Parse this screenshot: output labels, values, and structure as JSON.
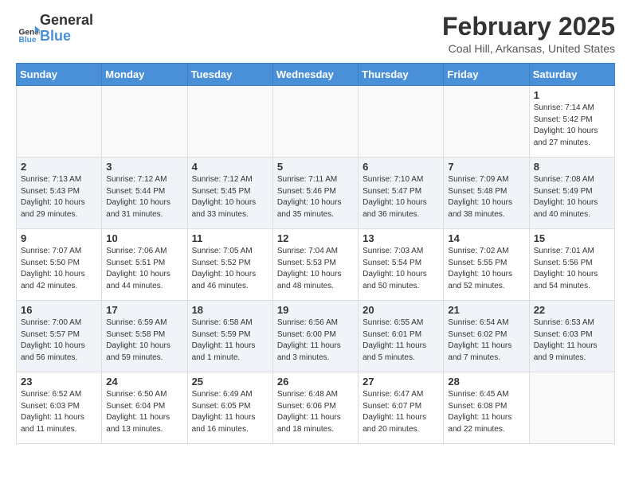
{
  "header": {
    "logo_general": "General",
    "logo_blue": "Blue",
    "month_title": "February 2025",
    "location": "Coal Hill, Arkansas, United States"
  },
  "calendar": {
    "days_of_week": [
      "Sunday",
      "Monday",
      "Tuesday",
      "Wednesday",
      "Thursday",
      "Friday",
      "Saturday"
    ],
    "weeks": [
      {
        "shade": false,
        "days": [
          {
            "num": "",
            "info": ""
          },
          {
            "num": "",
            "info": ""
          },
          {
            "num": "",
            "info": ""
          },
          {
            "num": "",
            "info": ""
          },
          {
            "num": "",
            "info": ""
          },
          {
            "num": "",
            "info": ""
          },
          {
            "num": "1",
            "info": "Sunrise: 7:14 AM\nSunset: 5:42 PM\nDaylight: 10 hours and 27 minutes."
          }
        ]
      },
      {
        "shade": true,
        "days": [
          {
            "num": "2",
            "info": "Sunrise: 7:13 AM\nSunset: 5:43 PM\nDaylight: 10 hours and 29 minutes."
          },
          {
            "num": "3",
            "info": "Sunrise: 7:12 AM\nSunset: 5:44 PM\nDaylight: 10 hours and 31 minutes."
          },
          {
            "num": "4",
            "info": "Sunrise: 7:12 AM\nSunset: 5:45 PM\nDaylight: 10 hours and 33 minutes."
          },
          {
            "num": "5",
            "info": "Sunrise: 7:11 AM\nSunset: 5:46 PM\nDaylight: 10 hours and 35 minutes."
          },
          {
            "num": "6",
            "info": "Sunrise: 7:10 AM\nSunset: 5:47 PM\nDaylight: 10 hours and 36 minutes."
          },
          {
            "num": "7",
            "info": "Sunrise: 7:09 AM\nSunset: 5:48 PM\nDaylight: 10 hours and 38 minutes."
          },
          {
            "num": "8",
            "info": "Sunrise: 7:08 AM\nSunset: 5:49 PM\nDaylight: 10 hours and 40 minutes."
          }
        ]
      },
      {
        "shade": false,
        "days": [
          {
            "num": "9",
            "info": "Sunrise: 7:07 AM\nSunset: 5:50 PM\nDaylight: 10 hours and 42 minutes."
          },
          {
            "num": "10",
            "info": "Sunrise: 7:06 AM\nSunset: 5:51 PM\nDaylight: 10 hours and 44 minutes."
          },
          {
            "num": "11",
            "info": "Sunrise: 7:05 AM\nSunset: 5:52 PM\nDaylight: 10 hours and 46 minutes."
          },
          {
            "num": "12",
            "info": "Sunrise: 7:04 AM\nSunset: 5:53 PM\nDaylight: 10 hours and 48 minutes."
          },
          {
            "num": "13",
            "info": "Sunrise: 7:03 AM\nSunset: 5:54 PM\nDaylight: 10 hours and 50 minutes."
          },
          {
            "num": "14",
            "info": "Sunrise: 7:02 AM\nSunset: 5:55 PM\nDaylight: 10 hours and 52 minutes."
          },
          {
            "num": "15",
            "info": "Sunrise: 7:01 AM\nSunset: 5:56 PM\nDaylight: 10 hours and 54 minutes."
          }
        ]
      },
      {
        "shade": true,
        "days": [
          {
            "num": "16",
            "info": "Sunrise: 7:00 AM\nSunset: 5:57 PM\nDaylight: 10 hours and 56 minutes."
          },
          {
            "num": "17",
            "info": "Sunrise: 6:59 AM\nSunset: 5:58 PM\nDaylight: 10 hours and 59 minutes."
          },
          {
            "num": "18",
            "info": "Sunrise: 6:58 AM\nSunset: 5:59 PM\nDaylight: 11 hours and 1 minute."
          },
          {
            "num": "19",
            "info": "Sunrise: 6:56 AM\nSunset: 6:00 PM\nDaylight: 11 hours and 3 minutes."
          },
          {
            "num": "20",
            "info": "Sunrise: 6:55 AM\nSunset: 6:01 PM\nDaylight: 11 hours and 5 minutes."
          },
          {
            "num": "21",
            "info": "Sunrise: 6:54 AM\nSunset: 6:02 PM\nDaylight: 11 hours and 7 minutes."
          },
          {
            "num": "22",
            "info": "Sunrise: 6:53 AM\nSunset: 6:03 PM\nDaylight: 11 hours and 9 minutes."
          }
        ]
      },
      {
        "shade": false,
        "days": [
          {
            "num": "23",
            "info": "Sunrise: 6:52 AM\nSunset: 6:03 PM\nDaylight: 11 hours and 11 minutes."
          },
          {
            "num": "24",
            "info": "Sunrise: 6:50 AM\nSunset: 6:04 PM\nDaylight: 11 hours and 13 minutes."
          },
          {
            "num": "25",
            "info": "Sunrise: 6:49 AM\nSunset: 6:05 PM\nDaylight: 11 hours and 16 minutes."
          },
          {
            "num": "26",
            "info": "Sunrise: 6:48 AM\nSunset: 6:06 PM\nDaylight: 11 hours and 18 minutes."
          },
          {
            "num": "27",
            "info": "Sunrise: 6:47 AM\nSunset: 6:07 PM\nDaylight: 11 hours and 20 minutes."
          },
          {
            "num": "28",
            "info": "Sunrise: 6:45 AM\nSunset: 6:08 PM\nDaylight: 11 hours and 22 minutes."
          },
          {
            "num": "",
            "info": ""
          }
        ]
      }
    ]
  }
}
